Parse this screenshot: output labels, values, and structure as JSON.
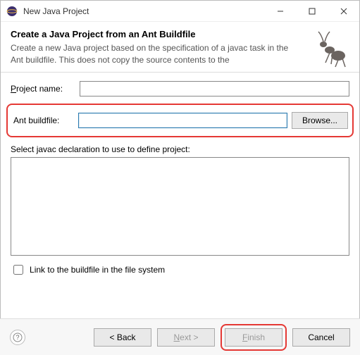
{
  "window": {
    "title": "New Java Project"
  },
  "banner": {
    "heading": "Create a Java Project from an Ant Buildfile",
    "description": "Create a new Java project based on the specification of a javac task in the Ant buildfile. This does not copy the source contents to the"
  },
  "form": {
    "project_name_label": "Project name:",
    "project_name_value": "",
    "ant_buildfile_label": "Ant buildfile:",
    "ant_buildfile_value": "",
    "browse_label": "Browse...",
    "javac_section_label": "Select javac declaration to use to define project:",
    "link_checkbox_label": "Link to the buildfile in the file system",
    "link_checked": false
  },
  "buttons": {
    "back": "< Back",
    "next": "Next >",
    "finish": "Finish",
    "cancel": "Cancel"
  }
}
